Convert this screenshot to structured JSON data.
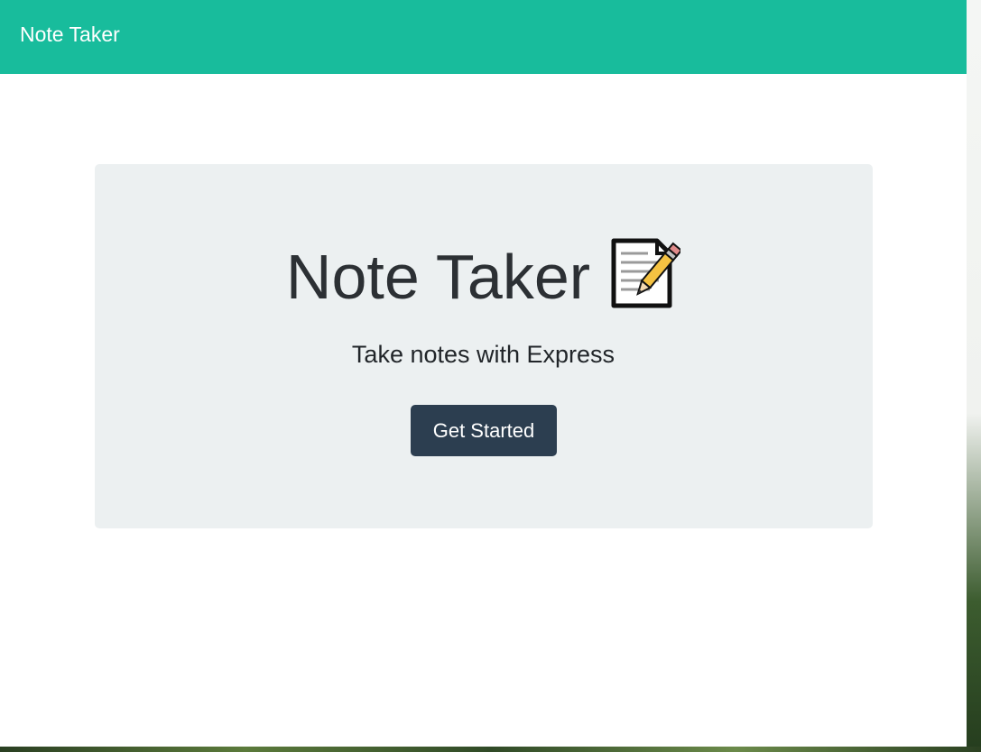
{
  "navbar": {
    "brand": "Note Taker"
  },
  "hero": {
    "title": "Note Taker",
    "title_icon": "memo-icon",
    "subtitle": "Take notes with Express",
    "button_label": "Get Started"
  },
  "colors": {
    "navbar": "#18bc9c",
    "jumbotron": "#ecf0f1",
    "button": "#2c3e50",
    "text": "#2c3034"
  }
}
